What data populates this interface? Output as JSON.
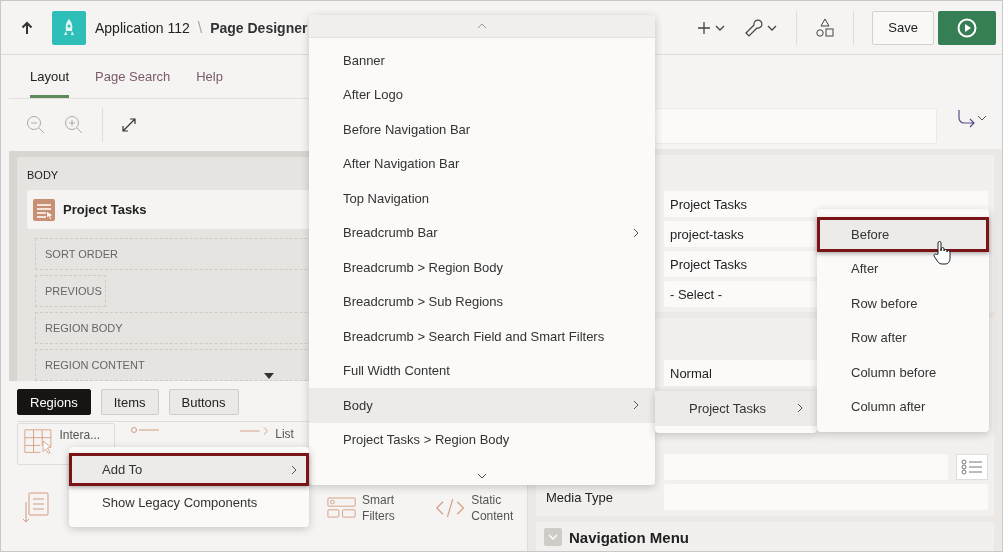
{
  "header": {
    "app_name": "Application 112",
    "separator": "\\",
    "page_title": "Page Designer",
    "save_label": "Save"
  },
  "left_tabs": [
    {
      "label": "Layout",
      "selected": true
    },
    {
      "label": "Page Search",
      "selected": false
    },
    {
      "label": "Help",
      "selected": false
    }
  ],
  "canvas": {
    "body_label": "BODY",
    "region_title": "Project Tasks",
    "slots": [
      "SORT ORDER",
      "PREVIOUS",
      "REGION BODY",
      "REGION CONTENT"
    ]
  },
  "gallery": {
    "tabs": [
      {
        "label": "Regions",
        "selected": true
      },
      {
        "label": "Items",
        "selected": false
      },
      {
        "label": "Buttons",
        "selected": false
      }
    ],
    "row_1": [
      {
        "kind": "grid",
        "label": "Intera..."
      },
      {
        "kind": "dotline"
      },
      {
        "kind": "arrowline",
        "label": "List"
      }
    ],
    "row_2": [
      {
        "kind": "reflow"
      },
      {
        "kind": "filters",
        "label": "Smart Filters"
      },
      {
        "kind": "code",
        "label": "Static Content"
      }
    ]
  },
  "properties": {
    "fields_1": [
      "Project Tasks",
      "project-tasks",
      "Project Tasks",
      "- Select -"
    ],
    "fields_2": [
      "Normal"
    ],
    "media_type_label": "Media Type",
    "section_title": "Navigation Menu"
  },
  "context_menu": [
    {
      "label": "Add To",
      "selected": true,
      "callout": true,
      "submenu": true
    },
    {
      "label": "Show Legacy Components",
      "selected": false,
      "callout": false,
      "submenu": false
    }
  ],
  "position_menu": [
    {
      "label": "Banner",
      "selected": false,
      "submenu": false
    },
    {
      "label": "After Logo",
      "selected": false,
      "submenu": false
    },
    {
      "label": "Before Navigation Bar",
      "selected": false,
      "submenu": false
    },
    {
      "label": "After Navigation Bar",
      "selected": false,
      "submenu": false
    },
    {
      "label": "Top Navigation",
      "selected": false,
      "submenu": false
    },
    {
      "label": "Breadcrumb Bar",
      "selected": false,
      "submenu": true
    },
    {
      "label": "Breadcrumb > Region Body",
      "selected": false,
      "submenu": false
    },
    {
      "label": "Breadcrumb > Sub Regions",
      "selected": false,
      "submenu": false
    },
    {
      "label": "Breadcrumb > Search Field and Smart Filters",
      "selected": false,
      "submenu": false
    },
    {
      "label": "Full Width Content",
      "selected": false,
      "submenu": false
    },
    {
      "label": "Body",
      "selected": true,
      "submenu": true
    },
    {
      "label": "Project Tasks > Region Body",
      "selected": false,
      "submenu": false
    }
  ],
  "region_menu": [
    {
      "label": "Project Tasks",
      "selected": true,
      "submenu": true
    }
  ],
  "placement_menu": [
    {
      "label": "Before",
      "selected": true,
      "callout": true
    },
    {
      "label": "After",
      "selected": false,
      "callout": false
    },
    {
      "label": "Row before",
      "selected": false,
      "callout": false
    },
    {
      "label": "Row after",
      "selected": false,
      "callout": false
    },
    {
      "label": "Column before",
      "selected": false,
      "callout": false
    },
    {
      "label": "Column after",
      "selected": false,
      "callout": false
    }
  ]
}
